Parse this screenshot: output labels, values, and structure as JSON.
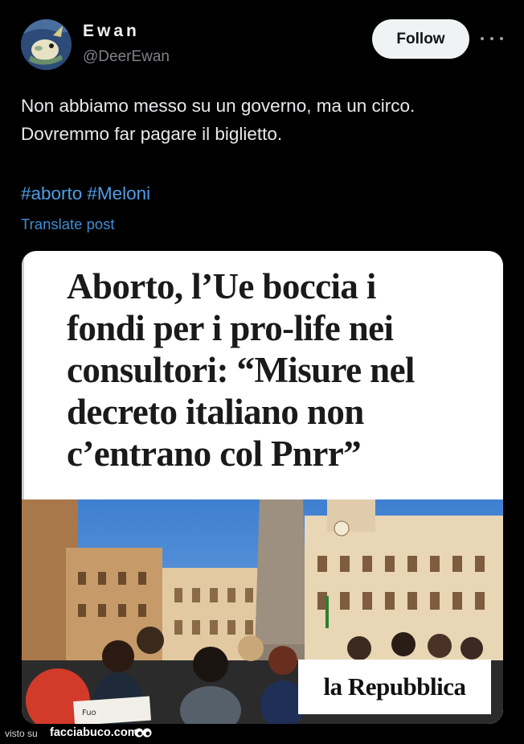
{
  "author": {
    "display_name": "Ewan",
    "handle": "@DeerEwan",
    "avatar_icon": "avatar-image"
  },
  "actions": {
    "follow_label": "Follow",
    "more_icon": "more-horizontal-icon"
  },
  "post": {
    "lines": [
      "Non abbiamo messo su un governo, ma un circo.",
      "Dovremmo far pagare il biglietto."
    ],
    "hashtags": [
      "#aborto",
      "#Meloni"
    ],
    "translate_label": "Translate post"
  },
  "media": {
    "headline_lines": [
      "Aborto, l’Ue boccia i",
      "fondi per i pro-life nei",
      "consultori: “Misure nel",
      "decreto italiano non",
      "c’entrano col Pnrr”"
    ],
    "logo": "la Repubblica",
    "placard_text": "Fuo"
  },
  "watermark": {
    "prefix": "visto su",
    "site": "facciabuco.com"
  },
  "colors": {
    "background": "#000000",
    "text": "#e7e9ea",
    "muted": "#7d8288",
    "link": "#4f9ee8",
    "follow_bg": "#eff3f4"
  }
}
